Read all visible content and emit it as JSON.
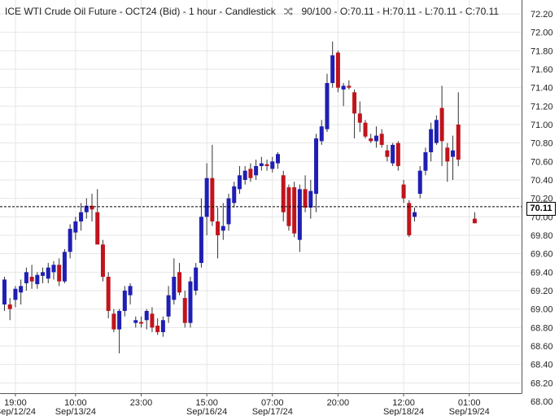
{
  "header": {
    "title": "ICE WTI Crude Oil Future - OCT24 (Bid) - 1 hour - Candlestick",
    "icon": "shuffle-icon",
    "ohlc": "90/100 - O:70.11 - H:70.11 - L:70.11 - C:70.11"
  },
  "last_price_badge": "70.11",
  "colors": {
    "up": "#1f1fb4",
    "down": "#c0141c",
    "grid": "#e6e6e6",
    "text": "#222222"
  },
  "chart_data": {
    "type": "candlestick",
    "title": "ICE WTI Crude Oil Future - OCT24 (Bid) - 1 hour - Candlestick",
    "ylim": [
      68.0,
      72.3
    ],
    "y_ticks": [
      "72.20",
      "72.00",
      "71.80",
      "71.60",
      "71.40",
      "71.20",
      "71.00",
      "70.80",
      "70.60",
      "70.40",
      "70.20",
      "70.00",
      "69.80",
      "69.60",
      "69.40",
      "69.20",
      "69.00",
      "68.80",
      "68.60",
      "68.40",
      "68.20",
      "68.00"
    ],
    "x_ticks": [
      {
        "time": "19:00",
        "date": "Sep/12/24",
        "bar": 2
      },
      {
        "time": "10:00",
        "date": "Sep/13/24",
        "bar": 13
      },
      {
        "time": "23:00",
        "date": "",
        "bar": 25
      },
      {
        "time": "15:00",
        "date": "Sep/16/24",
        "bar": 37
      },
      {
        "time": "07:00",
        "date": "Sep/17/24",
        "bar": 49
      },
      {
        "time": "20:00",
        "date": "",
        "bar": 61
      },
      {
        "time": "12:00",
        "date": "Sep/18/24",
        "bar": 73
      },
      {
        "time": "01:00",
        "date": "Sep/19/24",
        "bar": 85
      }
    ],
    "last_price": 70.11,
    "candles": [
      {
        "o": 69.05,
        "h": 69.35,
        "l": 68.98,
        "c": 69.32
      },
      {
        "o": 69.05,
        "h": 69.12,
        "l": 68.88,
        "c": 69.0
      },
      {
        "o": 69.1,
        "h": 69.25,
        "l": 69.02,
        "c": 69.22
      },
      {
        "o": 69.18,
        "h": 69.32,
        "l": 69.05,
        "c": 69.25
      },
      {
        "o": 69.28,
        "h": 69.45,
        "l": 69.2,
        "c": 69.4
      },
      {
        "o": 69.35,
        "h": 69.48,
        "l": 69.22,
        "c": 69.3
      },
      {
        "o": 69.27,
        "h": 69.4,
        "l": 69.22,
        "c": 69.37
      },
      {
        "o": 69.36,
        "h": 69.45,
        "l": 69.28,
        "c": 69.4
      },
      {
        "o": 69.33,
        "h": 69.5,
        "l": 69.28,
        "c": 69.45
      },
      {
        "o": 69.4,
        "h": 69.52,
        "l": 69.32,
        "c": 69.48
      },
      {
        "o": 69.48,
        "h": 69.55,
        "l": 69.25,
        "c": 69.3
      },
      {
        "o": 69.3,
        "h": 69.65,
        "l": 69.28,
        "c": 69.62
      },
      {
        "o": 69.62,
        "h": 69.92,
        "l": 69.55,
        "c": 69.87
      },
      {
        "o": 69.83,
        "h": 70.0,
        "l": 69.75,
        "c": 69.95
      },
      {
        "o": 69.95,
        "h": 70.15,
        "l": 69.85,
        "c": 70.05
      },
      {
        "o": 70.05,
        "h": 70.2,
        "l": 69.98,
        "c": 70.12
      },
      {
        "o": 70.12,
        "h": 70.25,
        "l": 69.95,
        "c": 70.08
      },
      {
        "o": 70.05,
        "h": 70.3,
        "l": 69.7,
        "c": 69.7
      },
      {
        "o": 69.7,
        "h": 69.75,
        "l": 69.3,
        "c": 69.35
      },
      {
        "o": 69.35,
        "h": 69.4,
        "l": 68.9,
        "c": 68.98
      },
      {
        "o": 68.95,
        "h": 69.0,
        "l": 68.75,
        "c": 68.78
      },
      {
        "o": 68.78,
        "h": 69.0,
        "l": 68.52,
        "c": 68.98
      },
      {
        "o": 68.98,
        "h": 69.25,
        "l": 68.92,
        "c": 69.2
      },
      {
        "o": 69.15,
        "h": 69.28,
        "l": 69.05,
        "c": 69.25
      },
      {
        "o": 68.85,
        "h": 68.92,
        "l": 68.8,
        "c": 68.88
      },
      {
        "o": 68.86,
        "h": 68.92,
        "l": 68.8,
        "c": 68.85
      },
      {
        "o": 68.88,
        "h": 69.0,
        "l": 68.78,
        "c": 68.98
      },
      {
        "o": 68.95,
        "h": 69.02,
        "l": 68.75,
        "c": 68.8
      },
      {
        "o": 68.82,
        "h": 68.9,
        "l": 68.72,
        "c": 68.75
      },
      {
        "o": 68.75,
        "h": 68.92,
        "l": 68.7,
        "c": 68.88
      },
      {
        "o": 68.92,
        "h": 69.25,
        "l": 68.85,
        "c": 69.15
      },
      {
        "o": 69.1,
        "h": 69.55,
        "l": 69.05,
        "c": 69.35
      },
      {
        "o": 69.4,
        "h": 69.5,
        "l": 69.15,
        "c": 69.18
      },
      {
        "o": 69.12,
        "h": 69.2,
        "l": 68.8,
        "c": 68.85
      },
      {
        "o": 68.85,
        "h": 69.35,
        "l": 68.8,
        "c": 69.3
      },
      {
        "o": 69.2,
        "h": 69.5,
        "l": 69.15,
        "c": 69.45
      },
      {
        "o": 69.5,
        "h": 70.2,
        "l": 69.45,
        "c": 70.0
      },
      {
        "o": 70.0,
        "h": 70.58,
        "l": 69.8,
        "c": 70.42
      },
      {
        "o": 70.42,
        "h": 70.78,
        "l": 69.9,
        "c": 69.95
      },
      {
        "o": 69.95,
        "h": 70.1,
        "l": 69.55,
        "c": 69.8
      },
      {
        "o": 69.85,
        "h": 70.15,
        "l": 69.75,
        "c": 69.9
      },
      {
        "o": 69.92,
        "h": 70.25,
        "l": 69.85,
        "c": 70.2
      },
      {
        "o": 70.15,
        "h": 70.38,
        "l": 70.1,
        "c": 70.33
      },
      {
        "o": 70.3,
        "h": 70.55,
        "l": 70.25,
        "c": 70.45
      },
      {
        "o": 70.4,
        "h": 70.55,
        "l": 70.35,
        "c": 70.5
      },
      {
        "o": 70.52,
        "h": 70.58,
        "l": 70.38,
        "c": 70.42
      },
      {
        "o": 70.45,
        "h": 70.62,
        "l": 70.4,
        "c": 70.55
      },
      {
        "o": 70.55,
        "h": 70.65,
        "l": 70.5,
        "c": 70.58
      },
      {
        "o": 70.57,
        "h": 70.62,
        "l": 70.5,
        "c": 70.55
      },
      {
        "o": 70.52,
        "h": 70.65,
        "l": 70.48,
        "c": 70.6
      },
      {
        "o": 70.58,
        "h": 70.7,
        "l": 70.52,
        "c": 70.68
      },
      {
        "o": 70.45,
        "h": 70.5,
        "l": 69.95,
        "c": 70.05
      },
      {
        "o": 70.32,
        "h": 70.35,
        "l": 69.85,
        "c": 69.9
      },
      {
        "o": 70.32,
        "h": 70.38,
        "l": 69.78,
        "c": 69.82
      },
      {
        "o": 69.75,
        "h": 70.35,
        "l": 69.62,
        "c": 70.3
      },
      {
        "o": 70.3,
        "h": 70.45,
        "l": 70.05,
        "c": 70.1
      },
      {
        "o": 70.1,
        "h": 70.4,
        "l": 69.98,
        "c": 70.28
      },
      {
        "o": 70.25,
        "h": 70.9,
        "l": 70.05,
        "c": 70.85
      },
      {
        "o": 70.82,
        "h": 71.05,
        "l": 70.78,
        "c": 70.98
      },
      {
        "o": 70.95,
        "h": 71.55,
        "l": 70.92,
        "c": 71.45
      },
      {
        "o": 71.45,
        "h": 71.9,
        "l": 71.4,
        "c": 71.75
      },
      {
        "o": 71.78,
        "h": 71.8,
        "l": 71.35,
        "c": 71.4
      },
      {
        "o": 71.38,
        "h": 71.45,
        "l": 71.2,
        "c": 71.42
      },
      {
        "o": 71.42,
        "h": 71.48,
        "l": 71.38,
        "c": 71.4
      },
      {
        "o": 71.35,
        "h": 71.38,
        "l": 70.85,
        "c": 71.12
      },
      {
        "o": 71.12,
        "h": 71.25,
        "l": 70.92,
        "c": 71.02
      },
      {
        "o": 71.02,
        "h": 71.05,
        "l": 70.85,
        "c": 70.87
      },
      {
        "o": 70.85,
        "h": 70.9,
        "l": 70.8,
        "c": 70.82
      },
      {
        "o": 70.82,
        "h": 70.98,
        "l": 70.75,
        "c": 70.88
      },
      {
        "o": 70.9,
        "h": 70.95,
        "l": 70.75,
        "c": 70.78
      },
      {
        "o": 70.72,
        "h": 70.78,
        "l": 70.6,
        "c": 70.65
      },
      {
        "o": 70.58,
        "h": 70.8,
        "l": 70.55,
        "c": 70.78
      },
      {
        "o": 70.8,
        "h": 70.82,
        "l": 70.5,
        "c": 70.55
      },
      {
        "o": 70.35,
        "h": 70.4,
        "l": 70.15,
        "c": 70.2
      },
      {
        "o": 70.15,
        "h": 70.18,
        "l": 69.78,
        "c": 69.8
      },
      {
        "o": 70.0,
        "h": 70.1,
        "l": 69.95,
        "c": 70.05
      },
      {
        "o": 70.25,
        "h": 70.55,
        "l": 70.2,
        "c": 70.5
      },
      {
        "o": 70.5,
        "h": 70.75,
        "l": 70.45,
        "c": 70.7
      },
      {
        "o": 70.7,
        "h": 71.02,
        "l": 70.6,
        "c": 70.95
      },
      {
        "o": 70.8,
        "h": 71.1,
        "l": 70.78,
        "c": 71.05
      },
      {
        "o": 71.18,
        "h": 71.42,
        "l": 70.55,
        "c": 70.82
      },
      {
        "o": 70.75,
        "h": 70.8,
        "l": 70.38,
        "c": 70.6
      },
      {
        "o": 70.65,
        "h": 70.88,
        "l": 70.4,
        "c": 70.72
      },
      {
        "o": 71.0,
        "h": 71.35,
        "l": 70.55,
        "c": 70.62
      },
      null,
      null,
      {
        "o": 69.98,
        "h": 70.05,
        "l": 69.93,
        "c": 69.93
      }
    ]
  }
}
